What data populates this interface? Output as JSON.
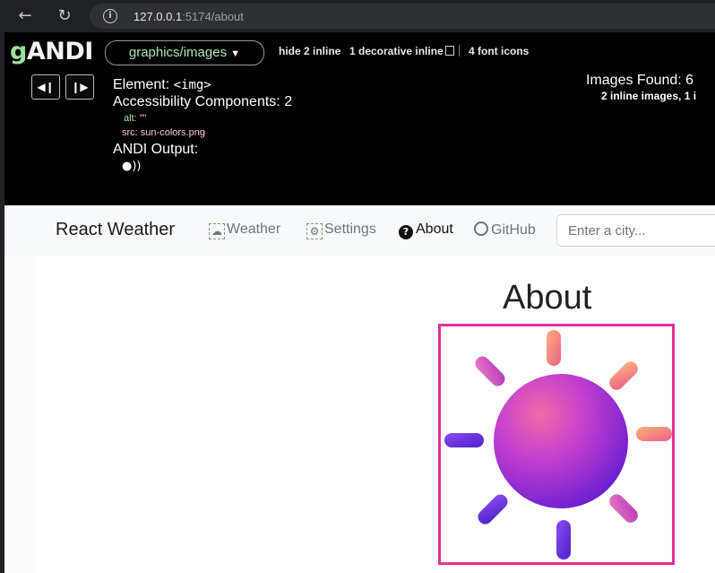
{
  "browser": {
    "url_host": "127.0.0.1",
    "url_path": ":5174/about",
    "icons": [
      "back-arrow-icon",
      "reload-icon",
      "info-icon"
    ]
  },
  "andi": {
    "logo_g": "g",
    "logo_rest": "ANDI",
    "module": "graphics/images",
    "options": {
      "hide_inline": "hide 2 inline",
      "decorative_inline": "1 decorative inline",
      "font_icons": "4 font icons"
    },
    "element_label": "Element:",
    "element_tag": "<img>",
    "accessibility_components": "Accessibility Components: 2",
    "components": [
      {
        "key": "alt:",
        "value": "\"\""
      },
      {
        "key": "src:",
        "value": "sun-colors.png"
      }
    ],
    "output_label": "ANDI Output:",
    "images_found": "Images Found: 6",
    "images_found_sub": "2 inline images, 1 i"
  },
  "site": {
    "brand": "React Weather",
    "nav": [
      {
        "label": "Weather",
        "icon": "weather-icon",
        "active": false
      },
      {
        "label": "Settings",
        "icon": "gear-icon",
        "active": false
      },
      {
        "label": "About",
        "icon": "question-icon",
        "active": true
      },
      {
        "label": "GitHub",
        "icon": "github-icon",
        "active": false
      }
    ],
    "search_placeholder": "Enter a city...",
    "page_title": "About",
    "image_src": "sun-colors.png"
  },
  "colors": {
    "highlight": "#e6309a",
    "andi_green": "#9fe0a0"
  }
}
